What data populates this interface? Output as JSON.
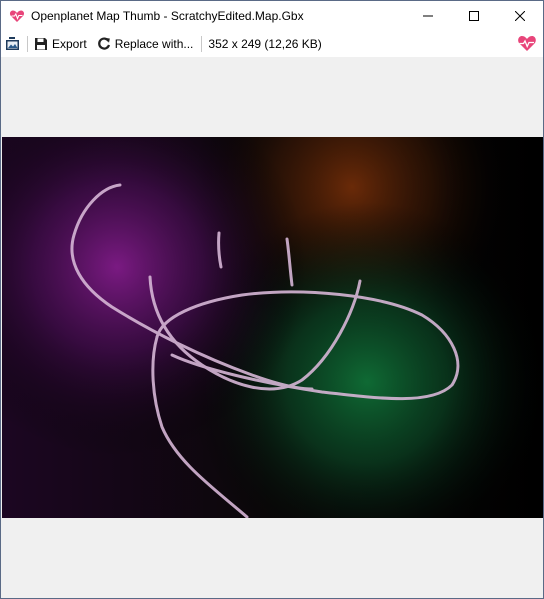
{
  "window": {
    "title": "Openplanet Map Thumb - ScratchyEdited.Map.Gbx",
    "app_icon": "heart-pulse-icon",
    "controls": [
      "minimize-icon",
      "maximize-icon",
      "close-icon"
    ]
  },
  "toolbar": {
    "open_icon": "open-image-icon",
    "export_label": "Export",
    "export_icon": "save-icon",
    "replace_label": "Replace with...",
    "replace_icon": "refresh-icon",
    "image_info": "352 x 249 (12,26 KB)",
    "right_icon": "heart-pulse-icon"
  },
  "colors": {
    "accent_heart": "#e8457a",
    "titlebar_bg": "#ffffff",
    "window_bg": "#f0f0f0",
    "stroke": "#d9b8d8"
  }
}
